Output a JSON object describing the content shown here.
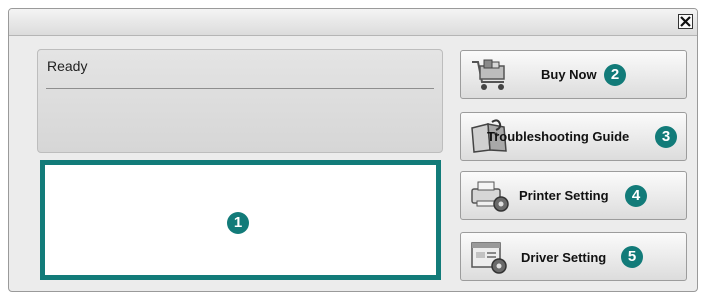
{
  "window": {
    "close_symbol": "✕"
  },
  "status": {
    "text": "Ready"
  },
  "display": {
    "callout": "1"
  },
  "buttons": {
    "buy_now": {
      "label": "Buy Now",
      "callout": "2",
      "icon": "shopping-cart-icon"
    },
    "troubleshooting": {
      "label": "Troubleshooting Guide",
      "callout": "3",
      "icon": "guide-book-icon"
    },
    "printer_setting": {
      "label": "Printer Setting",
      "callout": "4",
      "icon": "printer-gear-icon"
    },
    "driver_setting": {
      "label": "Driver Setting",
      "callout": "5",
      "icon": "driver-window-gear-icon"
    }
  },
  "colors": {
    "accent": "#127b79",
    "window_bg": "#ececec"
  }
}
